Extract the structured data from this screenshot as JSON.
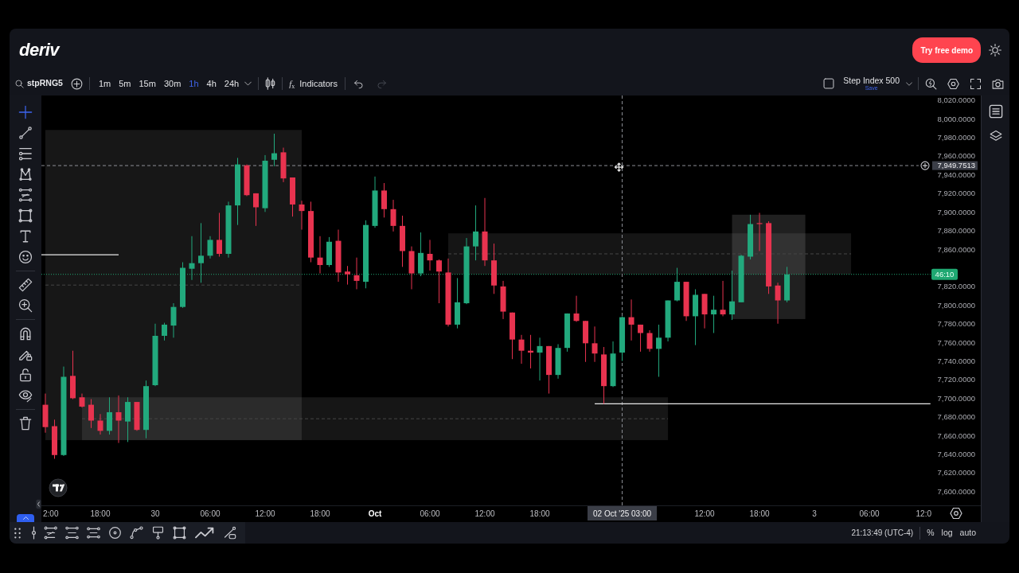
{
  "header": {
    "logo": "deriv",
    "demo_button": "Try free demo"
  },
  "toolbar": {
    "symbol": "stpRNG5",
    "intervals": [
      {
        "label": "1m",
        "selected": false
      },
      {
        "label": "5m",
        "selected": false
      },
      {
        "label": "15m",
        "selected": false
      },
      {
        "label": "30m",
        "selected": false
      },
      {
        "label": "1h",
        "selected": true
      },
      {
        "label": "4h",
        "selected": false
      },
      {
        "label": "24h",
        "selected": false
      }
    ],
    "indicators": {
      "icon": "*f*$_{x}$",
      "label": "Indicators"
    },
    "history": [
      {
        "kind": "undo",
        "disabled": false
      },
      {
        "kind": "redo",
        "disabled": true
      }
    ],
    "layout": {
      "name": "Step Index 500",
      "save": "Save"
    }
  },
  "drawing_tools": [
    [
      {
        "kind": "crosshair",
        "selected": true
      },
      {
        "kind": "trend-line",
        "selected": false
      },
      {
        "kind": "channel",
        "selected": false
      },
      {
        "kind": "pattern",
        "selected": false
      },
      {
        "kind": "fib",
        "selected": false
      },
      {
        "kind": "rectangle",
        "selected": false
      },
      {
        "kind": "text",
        "selected": false
      },
      {
        "kind": "emoji",
        "selected": false
      }
    ],
    [
      {
        "kind": "measure",
        "selected": false
      },
      {
        "kind": "zoom",
        "selected": false
      }
    ],
    [
      {
        "kind": "magnet",
        "selected": false
      },
      {
        "kind": "lock-drawing",
        "selected": false
      },
      {
        "kind": "lock",
        "selected": false
      },
      {
        "kind": "hide",
        "selected": false
      }
    ],
    [
      {
        "kind": "trash",
        "selected": false
      }
    ]
  ],
  "chart": {
    "chart_data": [
      {
        "type": "candlestick",
        "x": [
          "2025-09-29T12:00",
          "2025-09-29T13:00",
          "2025-09-29T14:00",
          "2025-09-29T15:00",
          "2025-09-29T16:00",
          "2025-09-29T17:00",
          "2025-09-29T18:00",
          "2025-09-29T19:00",
          "2025-09-29T20:00",
          "2025-09-29T21:00",
          "2025-09-29T22:00",
          "2025-09-29T23:00",
          "2025-09-30T00:00",
          "2025-09-30T01:00",
          "2025-09-30T02:00",
          "2025-09-30T03:00",
          "2025-09-30T04:00",
          "2025-09-30T05:00",
          "2025-09-30T06:00",
          "2025-09-30T07:00",
          "2025-09-30T08:00",
          "2025-09-30T09:00",
          "2025-09-30T10:00",
          "2025-09-30T11:00",
          "2025-09-30T12:00",
          "2025-09-30T13:00",
          "2025-09-30T14:00",
          "2025-09-30T15:00",
          "2025-09-30T16:00",
          "2025-09-30T17:00",
          "2025-09-30T18:00",
          "2025-09-30T19:00",
          "2025-09-30T20:00",
          "2025-09-30T21:00",
          "2025-09-30T22:00",
          "2025-09-30T23:00",
          "2025-10-01T00:00",
          "2025-10-01T01:00",
          "2025-10-01T02:00",
          "2025-10-01T03:00",
          "2025-10-01T04:00",
          "2025-10-01T05:00",
          "2025-10-01T06:00",
          "2025-10-01T07:00",
          "2025-10-01T08:00",
          "2025-10-01T09:00",
          "2025-10-01T10:00",
          "2025-10-01T11:00",
          "2025-10-01T12:00",
          "2025-10-01T13:00",
          "2025-10-01T14:00",
          "2025-10-01T15:00",
          "2025-10-01T16:00",
          "2025-10-01T17:00",
          "2025-10-01T18:00",
          "2025-10-01T19:00",
          "2025-10-01T20:00",
          "2025-10-01T21:00",
          "2025-10-01T22:00",
          "2025-10-01T23:00",
          "2025-10-02T00:00",
          "2025-10-02T01:00",
          "2025-10-02T02:00",
          "2025-10-02T03:00",
          "2025-10-02T04:00",
          "2025-10-02T05:00",
          "2025-10-02T06:00",
          "2025-10-02T07:00",
          "2025-10-02T08:00",
          "2025-10-02T09:00",
          "2025-10-02T10:00",
          "2025-10-02T11:00",
          "2025-10-02T12:00",
          "2025-10-02T13:00",
          "2025-10-02T14:00",
          "2025-10-02T15:00",
          "2025-10-02T16:00",
          "2025-10-02T17:00",
          "2025-10-02T18:00",
          "2025-10-02T19:00",
          "2025-10-02T20:00",
          "2025-10-02T21:00"
        ],
        "ohlc": [
          [
            7693,
            7705,
            7663,
            7669
          ],
          [
            7670,
            7677,
            7635,
            7639
          ],
          [
            7639,
            7734,
            7638,
            7723
          ],
          [
            7724,
            7751,
            7699,
            7700
          ],
          [
            7701,
            7705,
            7690,
            7691
          ],
          [
            7693,
            7699,
            7668,
            7676
          ],
          [
            7676,
            7683,
            7661,
            7665
          ],
          [
            7665,
            7701,
            7661,
            7685
          ],
          [
            7685,
            7703,
            7652,
            7676
          ],
          [
            7675,
            7701,
            7653,
            7696
          ],
          [
            7696,
            7696,
            7665,
            7666
          ],
          [
            7666,
            7719,
            7657,
            7713
          ],
          [
            7714,
            7780,
            7713,
            7767
          ],
          [
            7767,
            7781,
            7762,
            7779
          ],
          [
            7778,
            7802,
            7765,
            7798
          ],
          [
            7798,
            7846,
            7797,
            7840
          ],
          [
            7839,
            7874,
            7827,
            7845
          ],
          [
            7845,
            7888,
            7824,
            7853
          ],
          [
            7853,
            7874,
            7850,
            7870
          ],
          [
            7870,
            7899,
            7852,
            7855
          ],
          [
            7855,
            7911,
            7851,
            7907
          ],
          [
            7907,
            7958,
            7886,
            7951
          ],
          [
            7950,
            7951,
            7917,
            7918
          ],
          [
            7920,
            7920,
            7885,
            7905
          ],
          [
            7904,
            7961,
            7900,
            7955
          ],
          [
            7956,
            7984,
            7949,
            7963
          ],
          [
            7964,
            7969,
            7932,
            7936
          ],
          [
            7937,
            7937,
            7895,
            7908
          ],
          [
            7908,
            7912,
            7881,
            7901
          ],
          [
            7901,
            7911,
            7846,
            7851
          ],
          [
            7851,
            7874,
            7834,
            7843
          ],
          [
            7843,
            7873,
            7841,
            7868
          ],
          [
            7869,
            7881,
            7825,
            7835
          ],
          [
            7836,
            7842,
            7822,
            7833
          ],
          [
            7832,
            7851,
            7817,
            7826
          ],
          [
            7825,
            7891,
            7818,
            7886
          ],
          [
            7885,
            7938,
            7883,
            7923
          ],
          [
            7923,
            7931,
            7894,
            7903
          ],
          [
            7903,
            7913,
            7879,
            7885
          ],
          [
            7885,
            7896,
            7841,
            7858
          ],
          [
            7858,
            7863,
            7817,
            7834
          ],
          [
            7834,
            7878,
            7831,
            7856
          ],
          [
            7855,
            7870,
            7837,
            7848
          ],
          [
            7848,
            7849,
            7802,
            7836
          ],
          [
            7835,
            7850,
            7777,
            7779
          ],
          [
            7779,
            7829,
            7775,
            7803
          ],
          [
            7802,
            7872,
            7801,
            7863
          ],
          [
            7863,
            7907,
            7848,
            7879
          ],
          [
            7879,
            7915,
            7842,
            7848
          ],
          [
            7848,
            7866,
            7812,
            7821
          ],
          [
            7820,
            7826,
            7785,
            7793
          ],
          [
            7792,
            7792,
            7742,
            7763
          ],
          [
            7763,
            7768,
            7737,
            7751
          ],
          [
            7751,
            7768,
            7732,
            7749
          ],
          [
            7749,
            7765,
            7719,
            7756
          ],
          [
            7756,
            7756,
            7705,
            7725
          ],
          [
            7725,
            7758,
            7721,
            7754
          ],
          [
            7754,
            7791,
            7750,
            7791
          ],
          [
            7791,
            7810,
            7782,
            7783
          ],
          [
            7783,
            7783,
            7739,
            7759
          ],
          [
            7759,
            7777,
            7739,
            7748
          ],
          [
            7747,
            7755,
            7694,
            7713
          ],
          [
            7713,
            7761,
            7712,
            7748
          ],
          [
            7749,
            7788,
            7740,
            7787
          ],
          [
            7787,
            7806,
            7762,
            7779
          ],
          [
            7779,
            7779,
            7750,
            7770
          ],
          [
            7770,
            7773,
            7750,
            7753
          ],
          [
            7753,
            7779,
            7723,
            7765
          ],
          [
            7765,
            7805,
            7761,
            7805
          ],
          [
            7805,
            7840,
            7804,
            7825
          ],
          [
            7825,
            7825,
            7783,
            7788
          ],
          [
            7788,
            7817,
            7757,
            7811
          ],
          [
            7812,
            7812,
            7775,
            7790
          ],
          [
            7790,
            7810,
            7770,
            7795
          ],
          [
            7795,
            7826,
            7788,
            7790
          ],
          [
            7790,
            7837,
            7784,
            7804
          ],
          [
            7803,
            7854,
            7803,
            7853
          ],
          [
            7852,
            7897,
            7849,
            7887
          ],
          [
            7888,
            7899,
            7858,
            7887
          ],
          [
            7888,
            7890,
            7812,
            7820
          ],
          [
            7821,
            7824,
            7780,
            7805
          ],
          [
            7805,
            7841,
            7803,
            7833
          ]
        ],
        "xlim": [
          "2025-09-29T11:34",
          "2025-10-03T18:10"
        ],
        "ylim": [
          7585,
          8025
        ],
        "xticks": [
          {
            "value": "2025-09-29T12:00",
            "label": "2:00"
          },
          {
            "value": "2025-09-29T18:00",
            "label": "18:00"
          },
          {
            "value": "2025-09-30T00:00",
            "label": "30"
          },
          {
            "value": "2025-09-30T06:00",
            "label": "06:00"
          },
          {
            "value": "2025-09-30T12:00",
            "label": "12:00"
          },
          {
            "value": "2025-09-30T18:00",
            "label": "18:00"
          },
          {
            "value": "2025-10-01T00:00",
            "label": "Oct"
          },
          {
            "value": "2025-10-01T06:00",
            "label": "06:00"
          },
          {
            "value": "2025-10-01T12:00",
            "label": "12:00"
          },
          {
            "value": "2025-10-01T18:00",
            "label": "18:00"
          },
          {
            "value": "2025-10-02T12:00",
            "label": "12:00"
          },
          {
            "value": "2025-10-02T18:00",
            "label": "18:00"
          },
          {
            "value": "2025-10-03T00:00",
            "label": "3"
          },
          {
            "value": "2025-10-03T06:00",
            "label": "06:00"
          },
          {
            "value": "2025-10-03T12:00",
            "label": "12:0"
          }
        ],
        "yticks": [
          {
            "value": 8020,
            "label": "8,020.0000"
          },
          {
            "value": 8000,
            "label": "8,000.0000"
          },
          {
            "value": 7980,
            "label": "7,980.0000"
          },
          {
            "value": 7960,
            "label": "7,960.0000"
          },
          {
            "value": 7940,
            "label": "7,940.0000"
          },
          {
            "value": 7920,
            "label": "7,920.0000"
          },
          {
            "value": 7900,
            "label": "7,900.0000"
          },
          {
            "value": 7880,
            "label": "7,880.0000"
          },
          {
            "value": 7860,
            "label": "7,860.0000"
          },
          {
            "value": 7820,
            "label": "7,820.0000"
          },
          {
            "value": 7800,
            "label": "7,800.0000"
          },
          {
            "value": 7780,
            "label": "7,780.0000"
          },
          {
            "value": 7760,
            "label": "7,760.0000"
          },
          {
            "value": 7740,
            "label": "7,740.0000"
          },
          {
            "value": 7720,
            "label": "7,720.0000"
          },
          {
            "value": 7700,
            "label": "7,700.0000"
          },
          {
            "value": 7680,
            "label": "7,680.0000"
          },
          {
            "value": 7660,
            "label": "7,660.0000"
          },
          {
            "value": 7640,
            "label": "7,640.0000"
          },
          {
            "value": 7620,
            "label": "7,620.0000"
          },
          {
            "value": 7600,
            "label": "7,600.0000"
          }
        ],
        "ref_lines": [
          {
            "axis": "y",
            "value": 7833,
            "color": "#1fa872",
            "line_style": "dotted"
          },
          {
            "axis": "y",
            "value": 7949.7513,
            "label": "7,949.7513",
            "line_style": "dashed"
          },
          {
            "axis": "x",
            "value": "2025-10-02T03:00",
            "label": "02 Oct '25 03:00",
            "line_style": "dashed"
          },
          {
            "axis": "y",
            "value": 7694,
            "color": "#e8e8e8",
            "line_style": "solid"
          },
          {
            "axis": "y",
            "value": 7854,
            "color": "#e8e8e8",
            "line_style": "solid"
          },
          {
            "axis": "y",
            "value": 7821.5,
            "color": "#464646",
            "line_style": "dashed"
          },
          {
            "axis": "y",
            "value": 7678,
            "color": "#464646",
            "line_style": "dashed"
          },
          {
            "axis": "y",
            "value": 7855,
            "color": "#464646",
            "line_style": "dashed"
          }
        ],
        "bands": [
          {
            "axis": "y",
            "from": 7655,
            "to": 7988,
            "color": "#171717"
          },
          {
            "axis": "y",
            "from": 7655,
            "to": 7701,
            "color": "#161616"
          },
          {
            "axis": "y",
            "from": 7833,
            "to": 7877,
            "color": "#151515"
          },
          {
            "axis": "y",
            "from": 7785,
            "to": 7897,
            "color": "#202020"
          }
        ]
      }
    ],
    "countdown": "46:10"
  },
  "status_bar": {
    "clock": "21:13:49 (UTC-4)",
    "scale_options": [
      "%",
      "log",
      "auto"
    ]
  }
}
